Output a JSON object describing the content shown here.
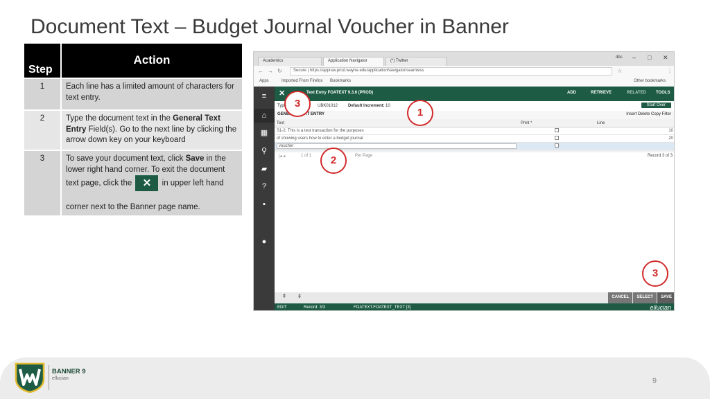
{
  "title": "Document Text – Budget Journal Voucher in Banner",
  "steps_table": {
    "header_step": "Step",
    "header_action": "Action",
    "rows": [
      {
        "num": "1",
        "text": "Each line has a limited amount of characters for text entry."
      },
      {
        "num": "2",
        "pre": "Type the document text in the ",
        "bold": "General Text Entry",
        "post": " Field(s).  Go to the next line by clicking the arrow down key on your keyboard"
      },
      {
        "num": "3",
        "pre": "To save your document text, click ",
        "bold": "Save",
        "post": " in the lower right hand corner. To exit the document text page, click the",
        "after_icon": "in upper left hand",
        "last_line": "corner next to the Banner page name.",
        "icon": "close-x"
      }
    ]
  },
  "screenshot": {
    "tabs": [
      "Academics",
      "Application Navigator",
      "(*) Twitter"
    ],
    "user": "dbs",
    "url": "Secure | https://appnav.prod.wayne.edu/applicationNavigator/seamless",
    "bookmarks": [
      "Apps",
      "Imported From Firefox",
      "Bookmarks",
      "Other bookmarks"
    ],
    "app_title": "Text Entry FOATEXT 9.3.6 (PROD)",
    "actions": [
      "ADD",
      "RETRIEVE",
      "RELATED",
      "TOOLS"
    ],
    "key_type_label": "Type",
    "key_doc": "UBK01012",
    "key_increment_label": "Default Increment:",
    "key_increment": "10",
    "start_over": "Start Over",
    "section_label": "GENERAL TEXT ENTRY",
    "section_tools": "Insert   Delete   Copy   Filter",
    "columns": [
      "Text",
      "Print *",
      "Line"
    ],
    "rows": [
      {
        "text": "S1-2: This is a test transaction for the purposes",
        "line": "10"
      },
      {
        "text": "of showing users how to enter a budget journal",
        "line": "20"
      },
      {
        "text": "voucher",
        "line": ""
      }
    ],
    "pager_left": "1  of 1",
    "pager_mid": "Per Page",
    "pager_right": "Record 3 of 3",
    "bottom_buttons": [
      "CANCEL",
      "SELECT",
      "SAVE"
    ],
    "status": [
      "EDIT",
      "Record: 3/3",
      "FOATEXT.FOATEXT_TEXT [3]"
    ],
    "brand": "ellucian"
  },
  "callouts": [
    "3",
    "1",
    "2",
    "3"
  ],
  "footer": {
    "logo_text": "BANNER 9",
    "logo_sub": "ellucian",
    "page_number": "9"
  },
  "colors": {
    "banner_green": "#1d5b45",
    "callout_red": "#d12a2a",
    "table_header": "#000000",
    "table_cell": "#d4d4d4"
  }
}
